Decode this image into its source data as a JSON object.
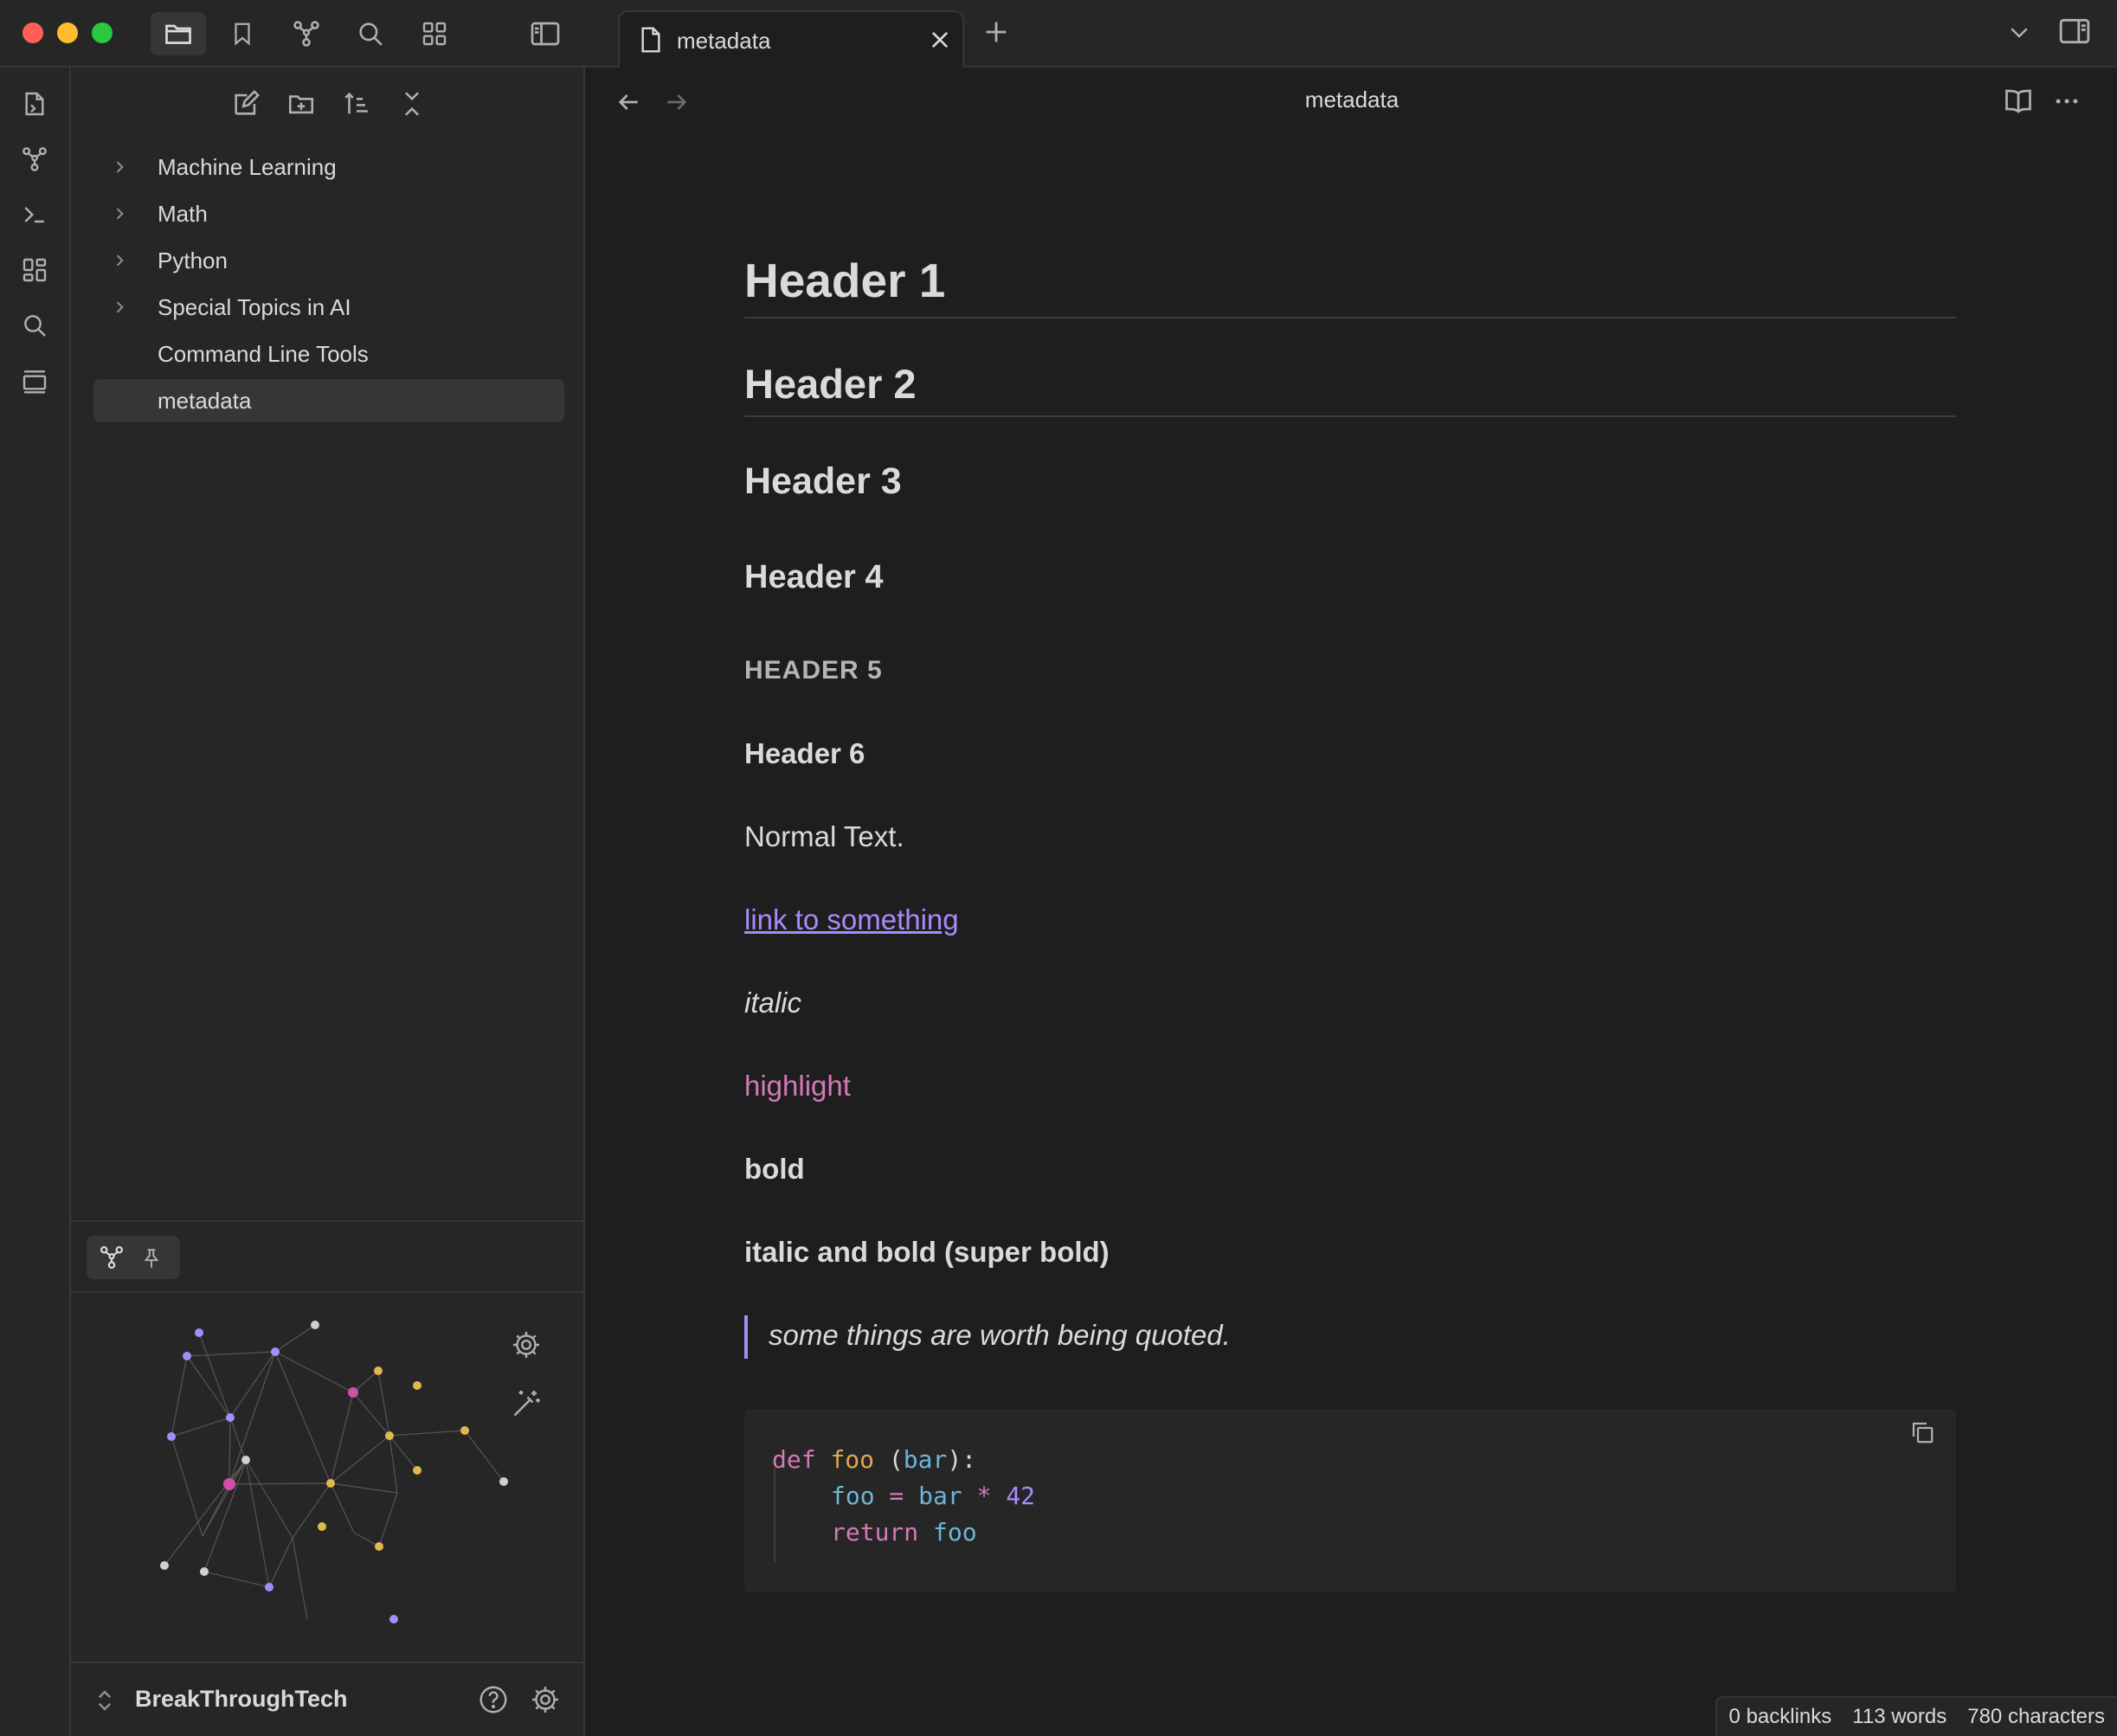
{
  "window": {
    "traffic_lights": {
      "close": "#ff5f57",
      "minimize": "#febc2e",
      "maximize": "#28c840"
    }
  },
  "titlebar": {
    "icons": [
      "folder-icon",
      "bookmark-icon",
      "graph-icon",
      "search-icon",
      "grid-icon",
      "sidebar-toggle-icon"
    ],
    "tab": {
      "label": "metadata",
      "icon": "file-icon"
    },
    "new_tab_icon": "plus-icon",
    "right_icons": [
      "chevron-down-icon",
      "right-sidebar-icon"
    ]
  },
  "ribbon": {
    "icons": [
      "open-quick-switcher-icon",
      "graph-view-icon",
      "terminal-icon",
      "canvas-icon",
      "search-icon",
      "slides-icon"
    ]
  },
  "sidebar": {
    "nav_icons": [
      "new-note-icon",
      "new-folder-icon",
      "sort-icon",
      "collapse-all-icon"
    ],
    "items": [
      {
        "label": "Machine Learning",
        "folder": true
      },
      {
        "label": "Math",
        "folder": true
      },
      {
        "label": "Python",
        "folder": true
      },
      {
        "label": "Special Topics in AI",
        "folder": true
      },
      {
        "label": "Command Line Tools",
        "folder": false
      },
      {
        "label": "metadata",
        "folder": false,
        "active": true
      }
    ],
    "graph": {
      "tab_icons": [
        "graph-icon",
        "pin-icon"
      ],
      "control_icons": [
        "gear-icon",
        "magic-wand-icon"
      ]
    },
    "vault": {
      "name": "BreakThroughTech",
      "icons": [
        "help-icon",
        "gear-icon"
      ]
    }
  },
  "main": {
    "view_title": "metadata",
    "nav_icons": [
      "back-arrow-icon",
      "forward-arrow-icon"
    ],
    "right_icons": [
      "reading-view-icon",
      "more-options-icon"
    ],
    "content": {
      "h1": "Header 1",
      "h2": "Header 2",
      "h3": "Header 3",
      "h4": "Header 4",
      "h5": "HEADER 5",
      "h6": "Header 6",
      "normal": "Normal Text.",
      "link": "link to something",
      "italic": "italic",
      "highlight": "highlight",
      "bold": "bold",
      "bold_italic": "italic and bold (super bold)",
      "quote": "some things are worth being quoted.",
      "code": {
        "line1": {
          "kw": "def",
          "fn": "foo",
          "open": " (",
          "arg": "bar",
          "close": "):"
        },
        "line2": {
          "lhs": "foo",
          "eq": " = ",
          "var": "bar",
          "op": " * ",
          "num": "42"
        },
        "line3": {
          "kw": "return",
          "var": "foo"
        },
        "copy_icon": "copy-icon"
      }
    }
  },
  "status": {
    "backlinks": "0 backlinks",
    "words": "113 words",
    "characters": "780 characters"
  },
  "colors": {
    "accent": "#a88bfa",
    "highlight": "#d47ab7",
    "background": "#1e1e1e",
    "panel": "#262626"
  }
}
